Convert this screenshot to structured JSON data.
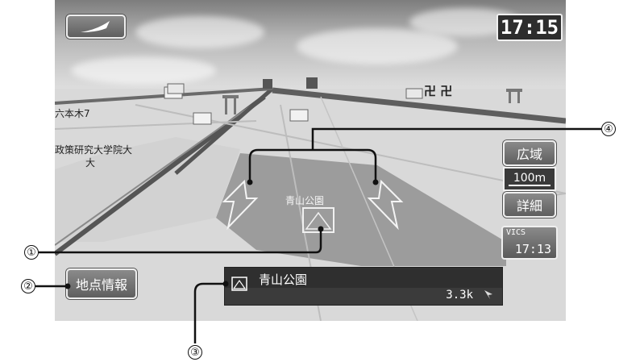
{
  "status": {
    "clock": "17:15"
  },
  "map": {
    "labels": [
      "六本木7",
      "政策研究大学院大",
      "大"
    ],
    "landmark_label": "青山公園",
    "icon_text": "卍 卍"
  },
  "controls": {
    "zoom_out_label": "広域",
    "scale_label": "100m",
    "zoom_in_label": "詳細",
    "vics_label": "VICS",
    "vics_time": "17:13",
    "point_info_label": "地点情報"
  },
  "destination": {
    "name": "青山公園",
    "distance": "3.3k"
  },
  "callouts": [
    "①",
    "②",
    "③",
    "④"
  ],
  "colors": {
    "button": "#6f6f6f",
    "road": "#5e5e5e",
    "area": "#9a9a9a",
    "panel": "#3b3b3b"
  },
  "icons": [
    "compass-icon",
    "park-icon",
    "cursor-icon",
    "arrow-left-icon",
    "arrow-right-icon",
    "shrine-icon"
  ]
}
